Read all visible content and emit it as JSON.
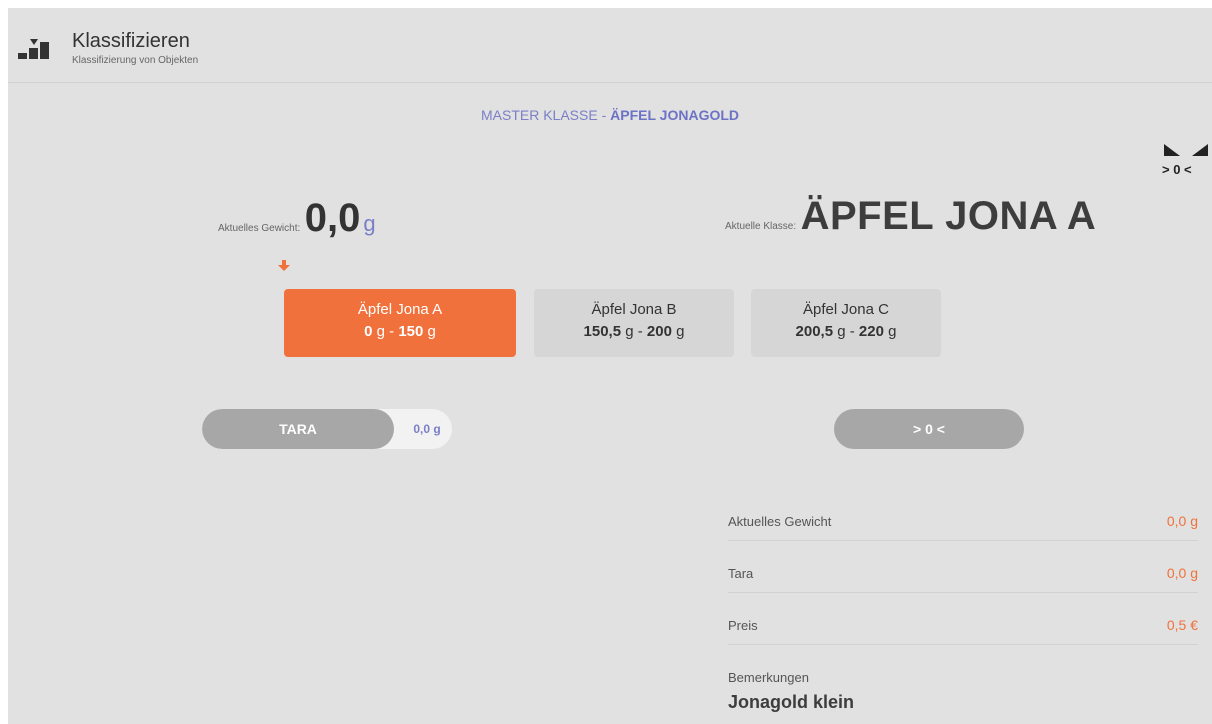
{
  "header": {
    "title": "Klassifizieren",
    "subtitle": "Klassifizierung von Objekten",
    "icon": "classify-icon"
  },
  "master": {
    "prefix": "MASTER KLASSE",
    "separator": " - ",
    "name": "ÄPFEL JONAGOLD"
  },
  "zero_indicator": {
    "icon": "zero-level-icon",
    "label": "> 0 <"
  },
  "current_weight": {
    "label": "Aktuelles Gewicht:",
    "value": "0,0",
    "unit": "g"
  },
  "current_class": {
    "label": "Aktuelle Klasse:",
    "value": "ÄPFEL JONA A"
  },
  "indicator_icon": "arrow-down-icon",
  "classes": [
    {
      "name": "Äpfel Jona A",
      "min": "0",
      "max": "150",
      "unit": "g",
      "sep": "-",
      "active": true
    },
    {
      "name": "Äpfel Jona B",
      "min": "150,5",
      "max": "200",
      "unit": "g",
      "sep": "-",
      "active": false
    },
    {
      "name": "Äpfel Jona C",
      "min": "200,5",
      "max": "220",
      "unit": "g",
      "sep": "-",
      "active": false
    }
  ],
  "tara": {
    "label": "TARA",
    "value": "0,0 g"
  },
  "zero_button": {
    "label": "> 0 <"
  },
  "info": [
    {
      "key": "Aktuelles Gewicht",
      "value": "0,0 g"
    },
    {
      "key": "Tara",
      "value": "0,0  g"
    },
    {
      "key": "Preis",
      "value": "0,5 €"
    }
  ],
  "remarks": {
    "label": "Bemerkungen",
    "value": "Jonagold klein"
  },
  "colors": {
    "accent": "#f0713b",
    "link": "#7a7fc6",
    "background": "#e1e1e1",
    "button_gray": "#a7a7a7"
  }
}
